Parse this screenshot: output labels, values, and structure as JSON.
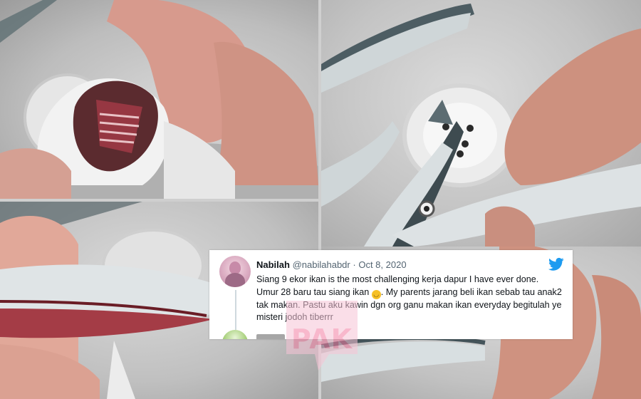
{
  "tweet": {
    "name": "Nabilah",
    "handle": "@nabilahabdr",
    "separator": "·",
    "date": "Oct 8, 2020",
    "text_part1": "Siang 9 ekor ikan is the most challenging kerja dapur I have ever done. Umur 28 baru tau siang ikan",
    "emoji": "upside-down-face-emoji",
    "text_part2": ". My parents jarang beli ikan sebab tau anak2 tak makan. Pastu aku kawin dgn org ganu makan ikan everyday begitulah ye misteri jodoh tiberrr",
    "icon": "twitter-bird-icon",
    "brand_color": "#1d9bf0"
  },
  "watermark": {
    "text": "PAK",
    "color": "#f37fa3"
  }
}
